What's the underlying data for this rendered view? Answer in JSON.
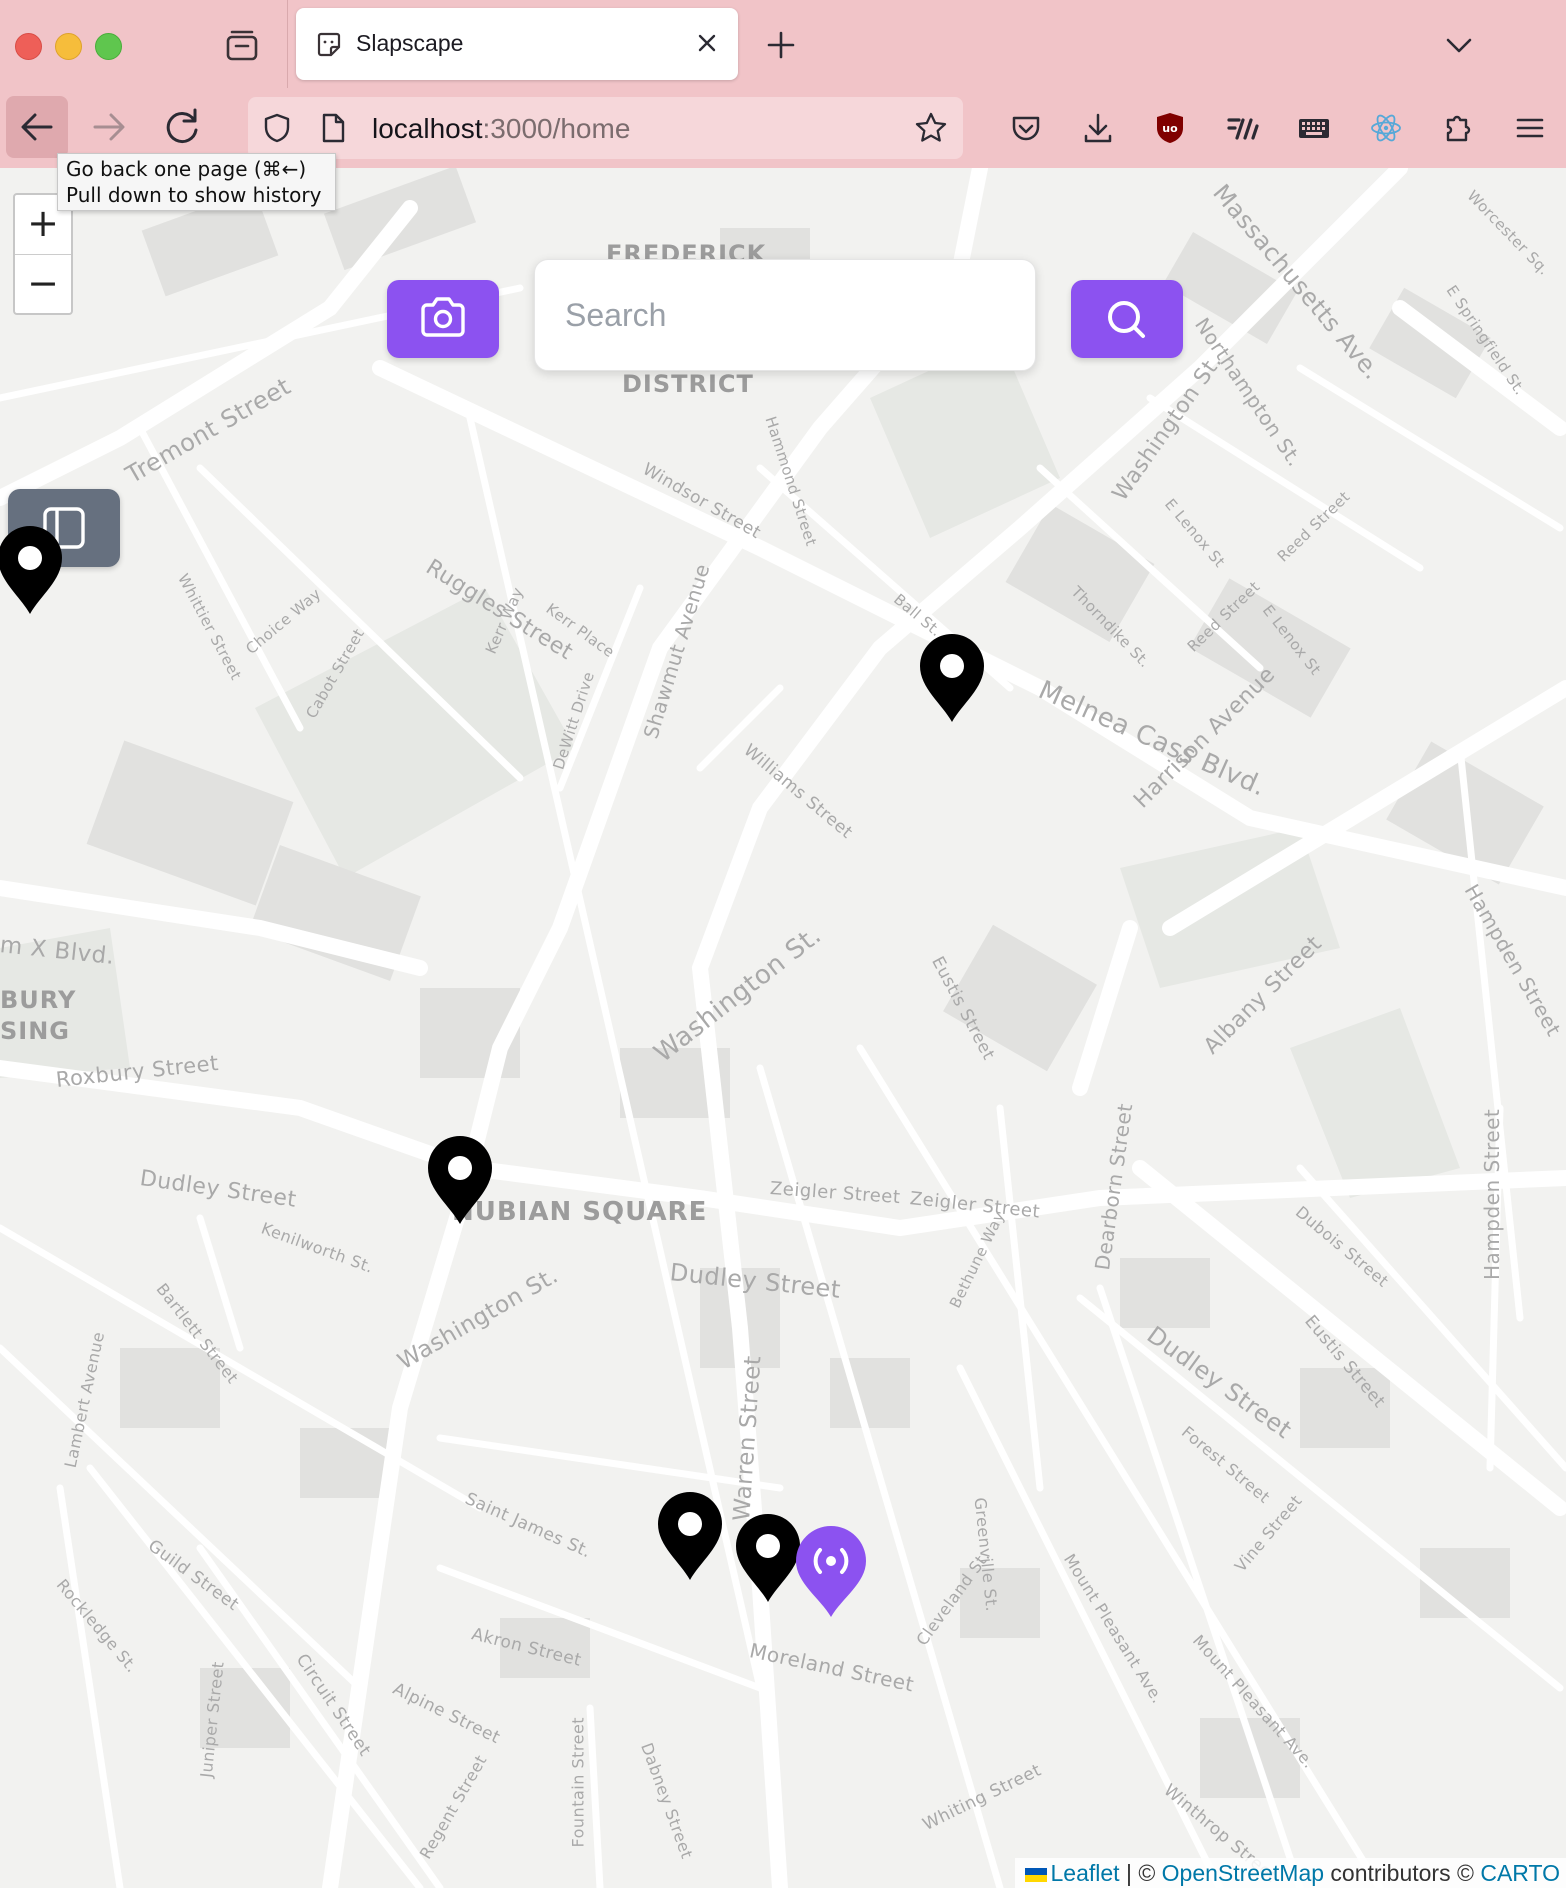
{
  "browser": {
    "tab_title": "Slapscape",
    "url_host": "localhost",
    "url_path": ":3000/home",
    "tooltip": [
      "Go back one page (⌘←)",
      "Pull down to show history"
    ]
  },
  "map": {
    "search_placeholder": "Search",
    "zoom_in": "+",
    "zoom_out": "−",
    "district_labels": [
      "FREDERICK",
      "DISTRICT",
      "BURY",
      "SING",
      "NUBIAN SQUARE"
    ],
    "street_labels": [
      "Tremont Street",
      "Ruggles Street",
      "Shawmut Avenue",
      "Washington St.",
      "Washington St.",
      "Washington St.",
      "Melnea Cass Blvd.",
      "Massachusetts Ave.",
      "Northampton St.",
      "Harrison Avenue",
      "Albany Street",
      "Hampden Street",
      "Hampden Street",
      "Dudley Street",
      "Dudley Street",
      "Dudley Street",
      "Roxbury Street",
      "Warren Street",
      "Moreland Street",
      "Zeigler Street",
      "Zeigler Street",
      "Eustis Street",
      "Eustis Street",
      "Dearborn Street",
      "Windsor Street",
      "Williams Street",
      "Kenilworth St.",
      "Bartlett Street",
      "Saint James St.",
      "Akron Street",
      "Alpine Street",
      "Circuit Street",
      "Guild Street",
      "Rockledge St.",
      "Lambert Avenue",
      "Juniper Street",
      "Regent Street",
      "Fountain Street",
      "Dabney Street",
      "Whiting Street",
      "Winthrop Street",
      "Mount Pleasant Ave.",
      "Mount Pleasant Ave.",
      "Greenville St.",
      "Cleveland St.",
      "Bethune Way",
      "Forest Street",
      "Vine Street",
      "Dubois Street",
      "Thorndike St.",
      "Reed Street",
      "Reed Street",
      "E Lenox St",
      "E Lenox St",
      "Ball St.",
      "Kerr Place",
      "Kerr Way",
      "DeWitt Drive",
      "Cabot Street",
      "Choice Way",
      "Whittier Street",
      "Hammond Street",
      "Worcester Sq.",
      "E Springfield St.",
      "m X Blvd."
    ],
    "attribution": {
      "leaflet": "Leaflet",
      "sep": " | © ",
      "osm": "OpenStreetMap",
      "contrib": " contributors © ",
      "carto": "CARTO"
    }
  }
}
